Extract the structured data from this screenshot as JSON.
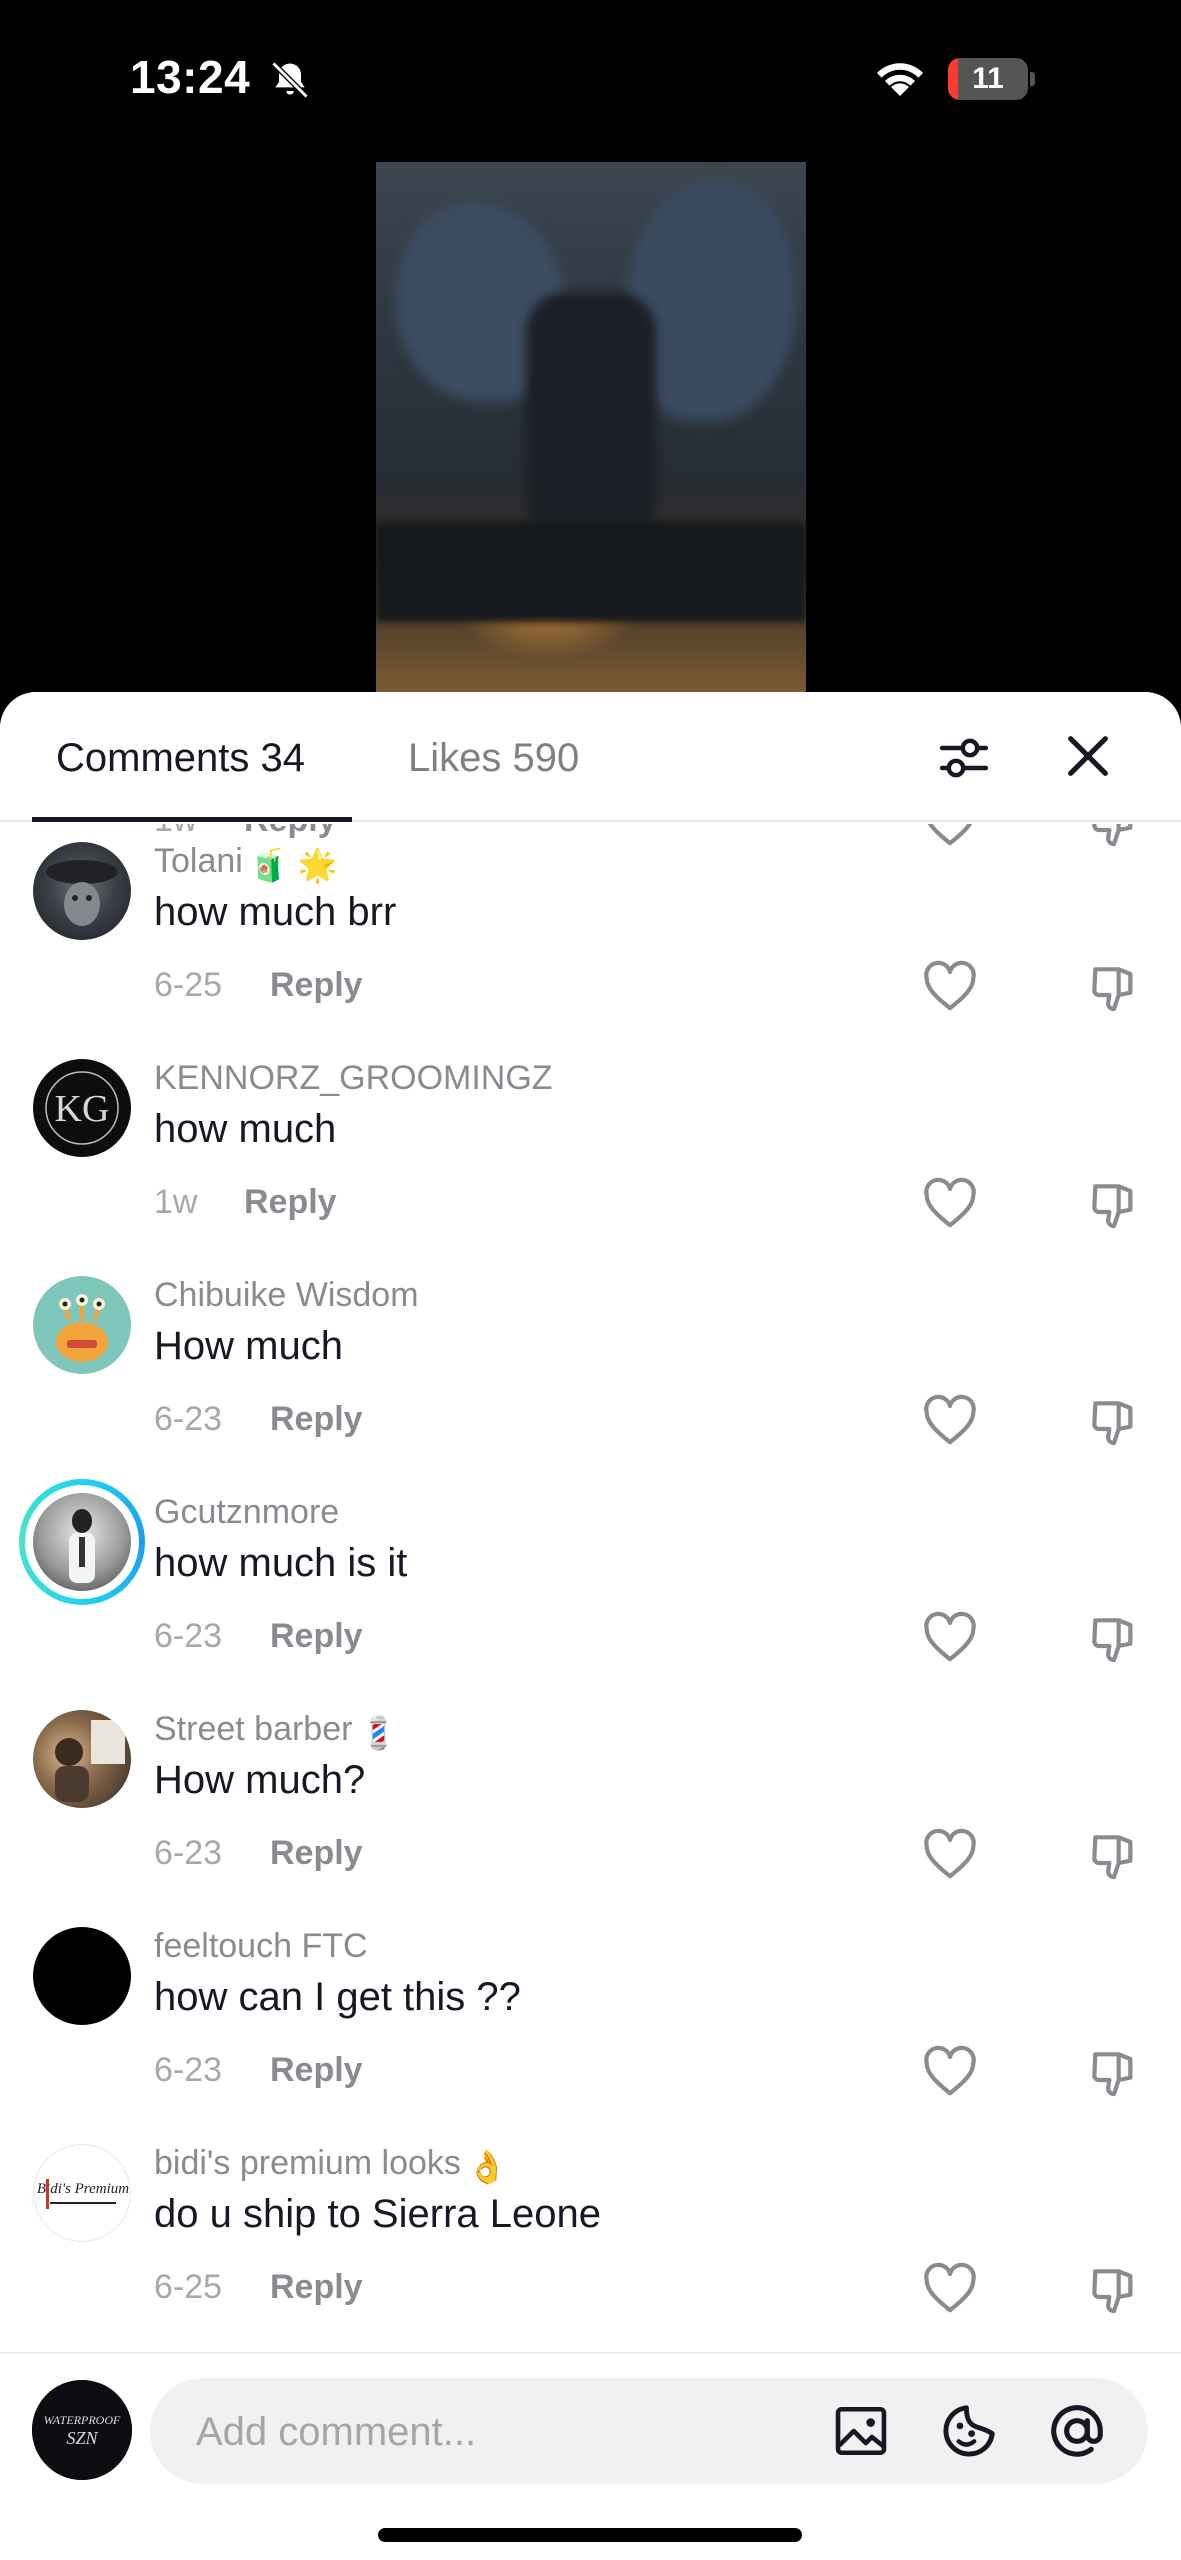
{
  "status_bar": {
    "time": "13:24",
    "battery_level": "11"
  },
  "tabs": {
    "comments_label": "Comments 34",
    "likes_label": "Likes 590"
  },
  "partial_top": {
    "timestamp": "1w",
    "reply_label": "Reply"
  },
  "comments": [
    {
      "username": "Tolani",
      "emoji": "🧃 🌟",
      "text": "how much brr",
      "timestamp": "6-25",
      "reply_label": "Reply"
    },
    {
      "username": "KENNORZ_GROOMINGZ",
      "emoji": "",
      "text": "how much",
      "timestamp": "1w",
      "reply_label": "Reply"
    },
    {
      "username": "Chibuike Wisdom",
      "emoji": "",
      "text": "How much",
      "timestamp": "6-23",
      "reply_label": "Reply"
    },
    {
      "username": "Gcutznmore",
      "emoji": "",
      "text": "how much is it",
      "timestamp": "6-23",
      "reply_label": "Reply"
    },
    {
      "username": "Street barber",
      "emoji": "💈",
      "text": "How much?",
      "timestamp": "6-23",
      "reply_label": "Reply"
    },
    {
      "username": "feeltouch FTC",
      "emoji": "",
      "text": "how can I get this ??",
      "timestamp": "6-23",
      "reply_label": "Reply"
    },
    {
      "username": "bidi's premium looks",
      "emoji": "👌",
      "text": "do u ship to Sierra Leone",
      "timestamp": "6-25",
      "reply_label": "Reply"
    }
  ],
  "avatars": {
    "kennorz_monogram": "KG",
    "bidi_logo": "Bidi's Premium",
    "my_avatar_lines": [
      "WATERPROOF",
      "SZN"
    ]
  },
  "composer": {
    "placeholder": "Add comment..."
  },
  "colors": {
    "primary_text": "#161823",
    "secondary_text": "#8a8b91",
    "story_ring": "#20d5ec"
  }
}
